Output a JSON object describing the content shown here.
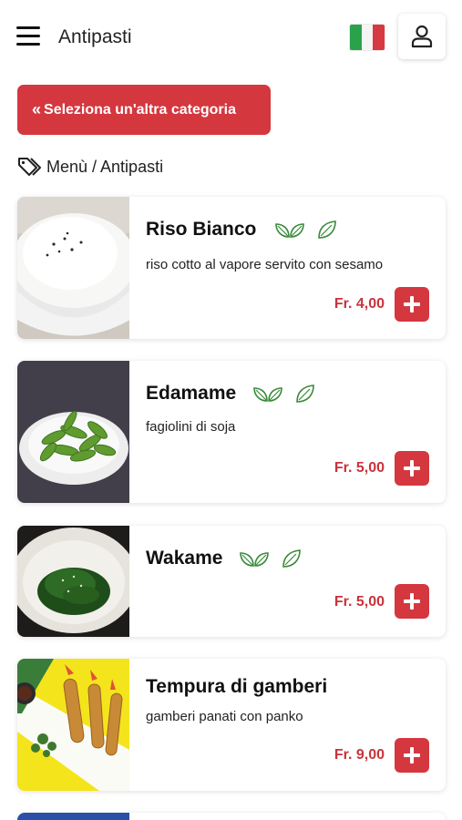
{
  "header": {
    "title": "Antipasti",
    "menu_icon": "hamburger-icon",
    "language_icon": "italy-flag-icon",
    "user_icon": "user-icon",
    "flag_colors": [
      "#2aa24a",
      "#f4f4f4",
      "#d8383f"
    ]
  },
  "back_button": {
    "label": "Seleziona un'altra categoria",
    "icon": "double-chevron-left-icon"
  },
  "breadcrumb": {
    "icon": "tags-icon",
    "text": "Menù / Antipasti"
  },
  "colors": {
    "accent": "#d5373f",
    "price": "#c8333b",
    "veg_icon": "#3a8a3a"
  },
  "products": [
    {
      "name": "Riso Bianco",
      "description": "riso cotto al vapore servito con sesamo",
      "price": "Fr. 4,00",
      "badges": [
        "vegetarian-leaves-icon",
        "vegan-leaf-icon"
      ]
    },
    {
      "name": "Edamame",
      "description": "fagiolini di soja",
      "price": "Fr. 5,00",
      "badges": [
        "vegetarian-leaves-icon",
        "vegan-leaf-icon"
      ]
    },
    {
      "name": "Wakame",
      "description": "",
      "price": "Fr. 5,00",
      "badges": [
        "vegetarian-leaves-icon",
        "vegan-leaf-icon"
      ]
    },
    {
      "name": "Tempura di gamberi",
      "description": "gamberi panati con panko",
      "price": "Fr. 9,00",
      "badges": []
    }
  ]
}
